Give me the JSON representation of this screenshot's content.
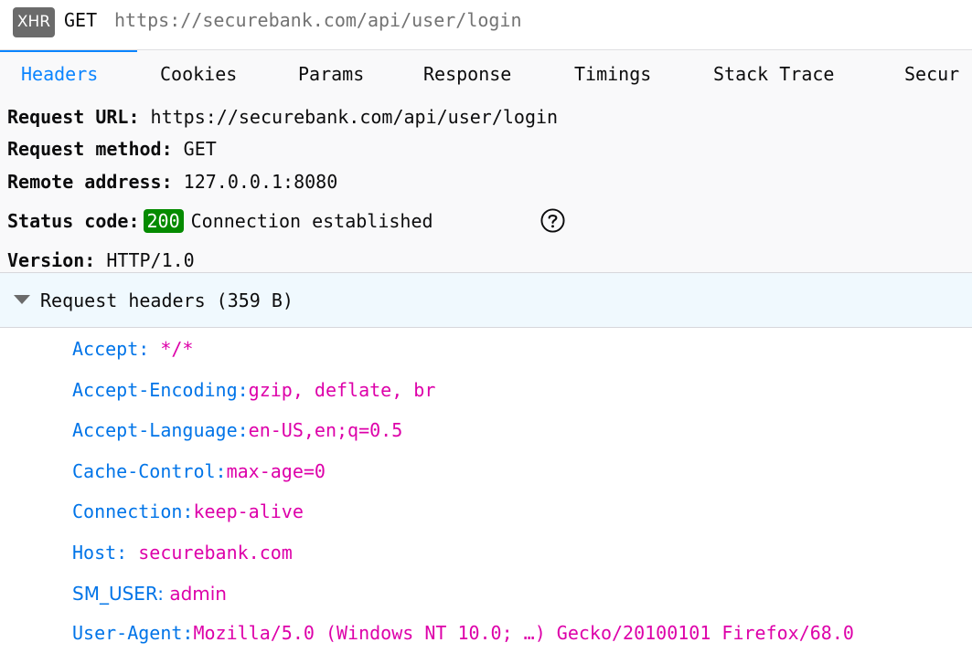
{
  "request": {
    "badge": "XHR",
    "method": "GET",
    "url": "https://securebank.com/api/user/login"
  },
  "tabs": [
    "Headers",
    "Cookies",
    "Params",
    "Response",
    "Timings",
    "Stack Trace",
    "Secur"
  ],
  "active_tab": "Headers",
  "summary": {
    "request_url_label": "Request URL:",
    "request_url": "https://securebank.com/api/user/login",
    "method_label": "Request method:",
    "method": "GET",
    "remote_label": "Remote address:",
    "remote": "127.0.0.1:8080",
    "status_label": "Status code:",
    "status_code": "200",
    "status_text": "Connection established",
    "version_label": "Version:",
    "version": "HTTP/1.0"
  },
  "request_headers": {
    "title": "Request headers (359 B)",
    "items": [
      {
        "name": "Accept:",
        "value": "*/*"
      },
      {
        "name": "Accept-Encoding:",
        "value": "gzip, deflate, br"
      },
      {
        "name": "Accept-Language:",
        "value": "en-US,en;q=0.5"
      },
      {
        "name": "Cache-Control:",
        "value": "max-age=0"
      },
      {
        "name": "Connection:",
        "value": "keep-alive"
      },
      {
        "name": "Host:",
        "value": "securebank.com"
      },
      {
        "name": "SM_USER:",
        "value": "admin"
      },
      {
        "name": "User-Agent:",
        "value": "Mozilla/5.0 (Windows NT 10.0; …) Gecko/20100101 Firefox/68.0"
      }
    ]
  },
  "colors": {
    "accent": "#0a84ff",
    "status_ok": "#058b00",
    "header_name": "#0074e8",
    "header_value": "#dd00a9"
  },
  "icons": {
    "help": "help-circle-icon",
    "twisty": "triangle-down-icon"
  }
}
